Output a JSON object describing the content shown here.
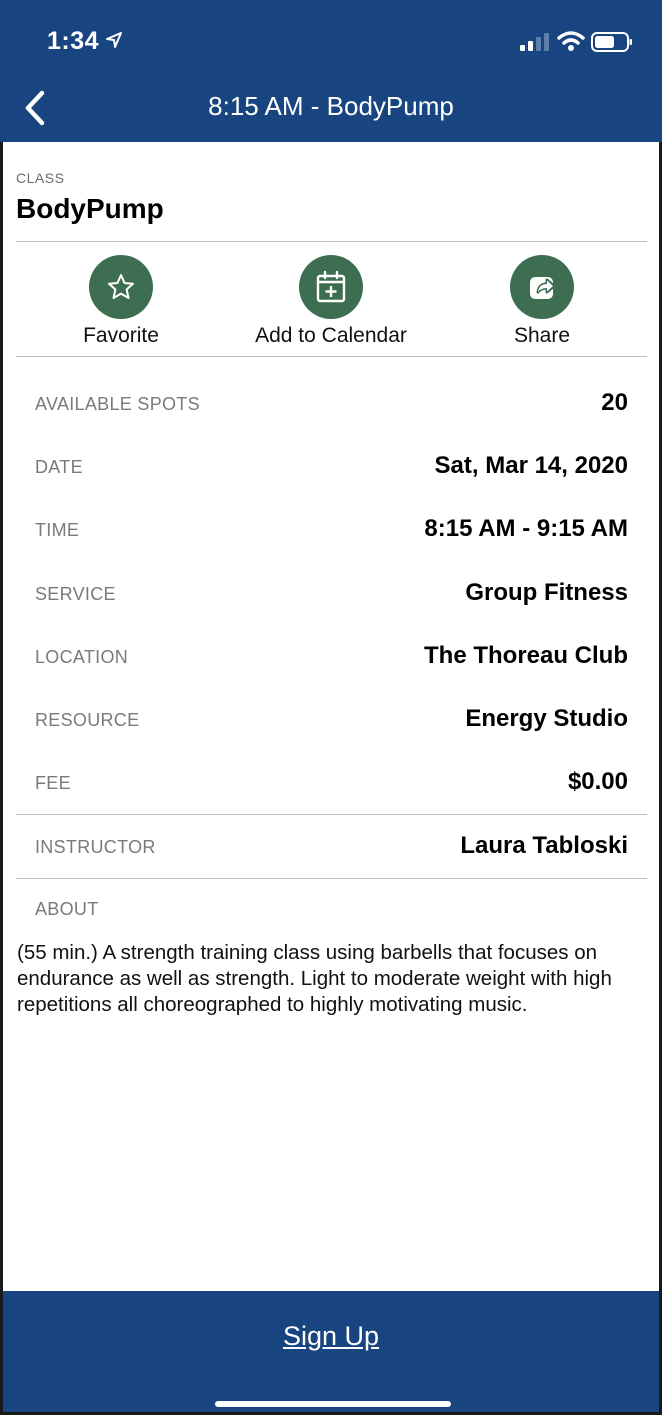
{
  "status_bar": {
    "time": "1:34"
  },
  "nav": {
    "title": "8:15 AM - BodyPump"
  },
  "class": {
    "label": "CLASS",
    "name": "BodyPump"
  },
  "actions": [
    {
      "label": "Favorite",
      "icon": "star-icon"
    },
    {
      "label": "Add to Calendar",
      "icon": "calendar-add-icon"
    },
    {
      "label": "Share",
      "icon": "share-icon"
    }
  ],
  "details": {
    "available_spots": {
      "label": "AVAILABLE SPOTS",
      "value": "20"
    },
    "date": {
      "label": "DATE",
      "value": "Sat, Mar 14, 2020"
    },
    "time": {
      "label": "TIME",
      "value": "8:15 AM - 9:15 AM"
    },
    "service": {
      "label": "SERVICE",
      "value": "Group Fitness"
    },
    "location": {
      "label": "LOCATION",
      "value": "The Thoreau Club"
    },
    "resource": {
      "label": "RESOURCE",
      "value": "Energy Studio"
    },
    "fee": {
      "label": "FEE",
      "value": "$0.00"
    },
    "instructor": {
      "label": "INSTRUCTOR",
      "value": "Laura Tabloski"
    }
  },
  "about": {
    "label": "ABOUT",
    "text": "(55 min.) A strength training class using barbells that focuses on endurance as well as strength. Light to moderate weight with high repetitions all choreographed to highly motivating music."
  },
  "footer": {
    "signup_label": "Sign Up"
  },
  "colors": {
    "header_bg": "#184580",
    "action_green": "#3e6e51"
  }
}
